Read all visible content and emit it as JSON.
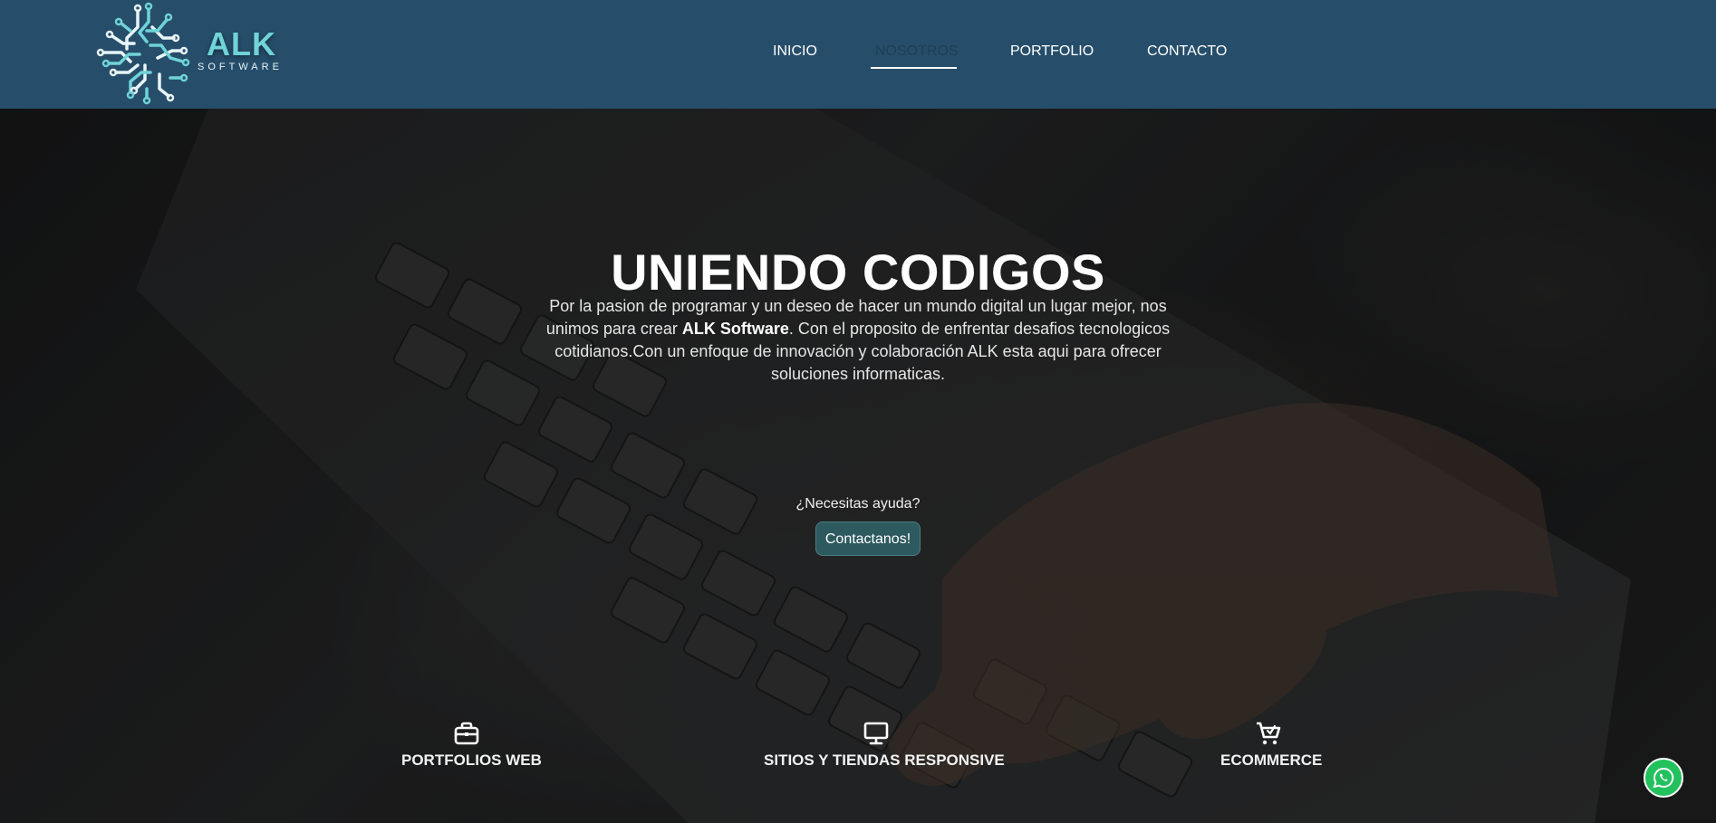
{
  "header": {
    "logo": {
      "main": "ALK",
      "sub": "SOFTWARE"
    },
    "nav": [
      {
        "label": "INICIO",
        "active": false
      },
      {
        "label": "NOSOTROS",
        "active": true
      },
      {
        "label": "PORTFOLIO",
        "active": false
      },
      {
        "label": "CONTACTO",
        "active": false
      }
    ]
  },
  "hero": {
    "title": "UNIENDO CODIGOS",
    "text_before": "Por la pasion de programar y un deseo de hacer un mundo digital un lugar mejor, nos unimos para crear ",
    "text_bold": "ALK Software",
    "text_after": ". Con el proposito de enfrentar desafios tecnologicos cotidianos.Con un enfoque de innovación y colaboración ALK esta aqui para ofrecer soluciones informaticas.",
    "help_label": "¿Necesitas ayuda?",
    "contact_button": "Contactanos!"
  },
  "features": [
    {
      "label": "PORTFOLIOS WEB",
      "icon": "briefcase-icon"
    },
    {
      "label": "SITIOS Y TIENDAS RESPONSIVE",
      "icon": "monitor-icon"
    },
    {
      "label": "ECOMMERCE",
      "icon": "cart-icon"
    }
  ],
  "floating": {
    "whatsapp_icon": "whatsapp-icon"
  },
  "colors": {
    "header_bg": "#264e6b",
    "logo_accent": "#6fd3d8",
    "button_bg": "#2d5a5f",
    "whatsapp": "#22c15e"
  }
}
